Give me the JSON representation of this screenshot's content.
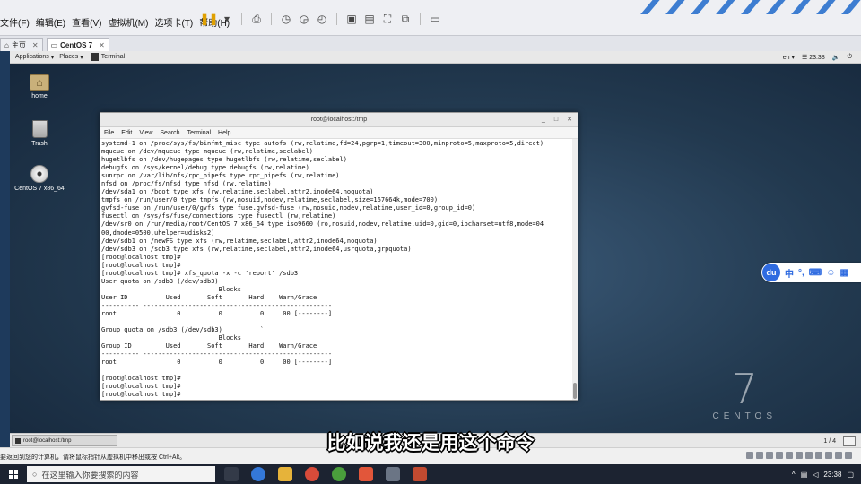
{
  "vmware": {
    "menus": [
      "文件(F)",
      "编辑(E)",
      "查看(V)",
      "虚拟机(M)",
      "选项卡(T)",
      "帮助(H)"
    ],
    "tabs": [
      {
        "label": "主页"
      },
      {
        "label": "CentOS 7"
      }
    ],
    "status_hint": "要返回到您的计算机，请将鼠标指针从虚拟机中移出或按 Ctrl+Alt。"
  },
  "gnome": {
    "applications": "Applications",
    "places": "Places",
    "task": "Terminal",
    "lang": "en",
    "time": "23:38"
  },
  "desktop": {
    "icons": [
      {
        "label": "home"
      },
      {
        "label": "Trash"
      },
      {
        "label": "CentOS 7 x86_64"
      }
    ]
  },
  "terminal": {
    "title": "root@localhost:/tmp",
    "menu": [
      "File",
      "Edit",
      "View",
      "Search",
      "Terminal",
      "Help"
    ],
    "output": "systemd-1 on /proc/sys/fs/binfmt_misc type autofs (rw,relatime,fd=24,pgrp=1,timeout=300,minproto=5,maxproto=5,direct)\nmqueue on /dev/mqueue type mqueue (rw,relatime,seclabel)\nhugetlbfs on /dev/hugepages type hugetlbfs (rw,relatime,seclabel)\ndebugfs on /sys/kernel/debug type debugfs (rw,relatime)\nsunrpc on /var/lib/nfs/rpc_pipefs type rpc_pipefs (rw,relatime)\nnfsd on /proc/fs/nfsd type nfsd (rw,relatime)\n/dev/sda1 on /boot type xfs (rw,relatime,seclabel,attr2,inode64,noquota)\ntmpfs on /run/user/0 type tmpfs (rw,nosuid,nodev,relatime,seclabel,size=167664k,mode=700)\ngvfsd-fuse on /run/user/0/gvfs type fuse.gvfsd-fuse (rw,nosuid,nodev,relatime,user_id=0,group_id=0)\nfusectl on /sys/fs/fuse/connections type fusectl (rw,relatime)\n/dev/sr0 on /run/media/root/CentOS 7 x86_64 type iso9660 (ro,nosuid,nodev,relatime,uid=0,gid=0,iocharset=utf8,mode=04\n00,dmode=0500,uhelper=udisks2)\n/dev/sdb1 on /newFS type xfs (rw,relatime,seclabel,attr2,inode64,noquota)\n/dev/sdb3 on /sdb3 type xfs (rw,relatime,seclabel,attr2,inode64,usrquota,grpquota)\n[root@localhost tmp]#\n[root@localhost tmp]#\n[root@localhost tmp]# xfs_quota -x -c 'report' /sdb3\nUser quota on /sdb3 (/dev/sdb3)\n                               Blocks\nUser ID          Used       Soft       Hard    Warn/Grace\n---------- --------------------------------------------------\nroot                0          0          0     00 [--------]\n\nGroup quota on /sdb3 (/dev/sdb3)          `\n                               Blocks\nGroup ID         Used       Soft       Hard    Warn/Grace\n---------- --------------------------------------------------\nroot                0          0          0     00 [--------]\n\n[root@localhost tmp]#\n[root@localhost tmp]#\n[root@localhost tmp]#"
  },
  "ime": {
    "logo": "du",
    "mode": "中"
  },
  "centos": {
    "seven": "7",
    "word": "CENTOS"
  },
  "guest_bottom": {
    "task": "root@localhost:/tmp",
    "page": "1 / 4"
  },
  "windows": {
    "search_placeholder": "在这里输入你要搜索的内容",
    "time": "23:38"
  },
  "subtitle": "比如说我还是用这个命令",
  "colors": {
    "accent": "#3d7dd1",
    "ime_blue": "#2f6be0"
  }
}
